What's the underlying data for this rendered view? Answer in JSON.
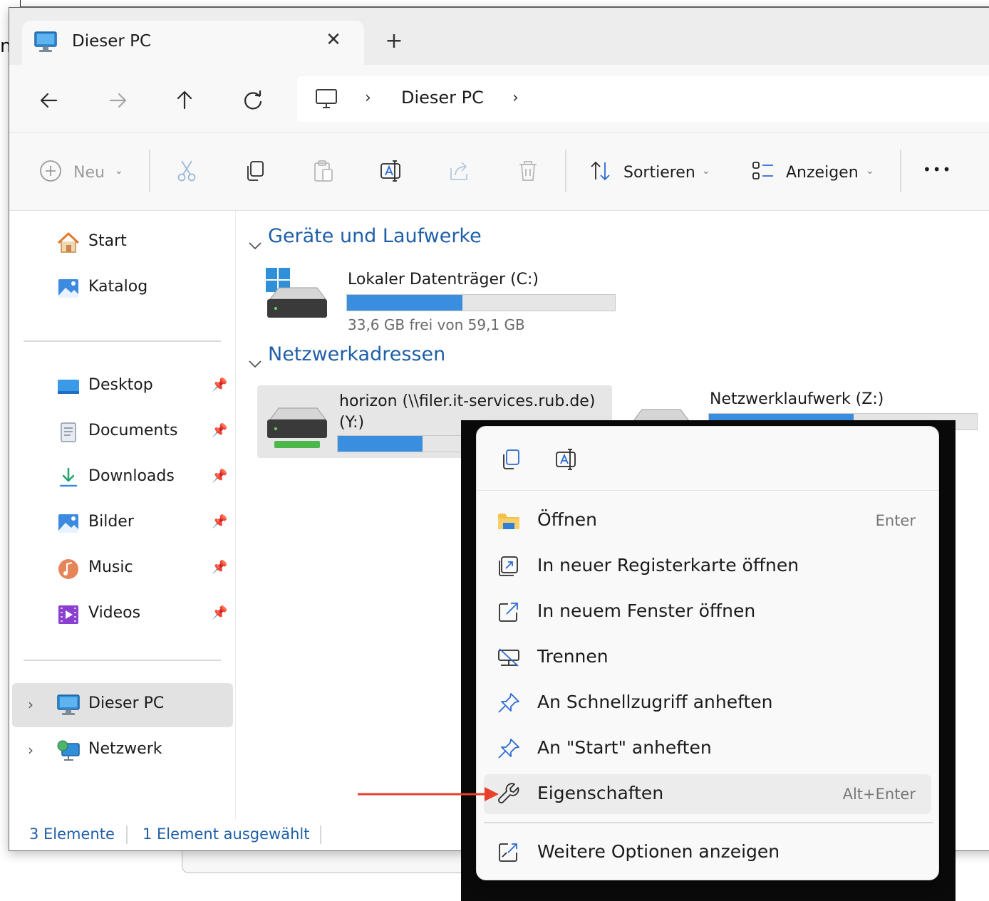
{
  "tab": {
    "title": "Dieser PC",
    "close_glyph": "✕",
    "new_tab_glyph": "+"
  },
  "nav": {
    "back_icon": "arrow-left-icon",
    "forward_icon": "arrow-right-icon",
    "up_icon": "arrow-up-icon",
    "refresh_icon": "refresh-icon",
    "breadcrumb": "Dieser PC"
  },
  "toolbar": {
    "new_label": "Neu",
    "sort_label": "Sortieren",
    "view_label": "Anzeigen",
    "more_label": "•••"
  },
  "sidebar": {
    "top_items": [
      {
        "label": "Start",
        "icon": "home-icon"
      },
      {
        "label": "Katalog",
        "icon": "gallery-icon"
      }
    ],
    "pinned": [
      {
        "label": "Desktop",
        "icon": "desktop-icon"
      },
      {
        "label": "Documents",
        "icon": "documents-icon"
      },
      {
        "label": "Downloads",
        "icon": "download-icon"
      },
      {
        "label": "Bilder",
        "icon": "pictures-icon"
      },
      {
        "label": "Music",
        "icon": "music-icon"
      },
      {
        "label": "Videos",
        "icon": "videos-icon"
      }
    ],
    "roots": [
      {
        "label": "Dieser PC",
        "icon": "pc-icon",
        "selected": true
      },
      {
        "label": "Netzwerk",
        "icon": "network-icon",
        "selected": false
      }
    ]
  },
  "content": {
    "group_devices": "Geräte und Laufwerke",
    "group_network": "Netzwerkadressen",
    "drive_c": {
      "name": "Lokaler Datenträger (C:)",
      "free_text": "33,6 GB frei von 59,1 GB",
      "used_fraction": 0.43
    },
    "drive_y": {
      "name_line1": "horizon (\\\\filer.it-services.rub.de)",
      "name_line2": "(Y:)",
      "used_fraction": 0.4
    },
    "drive_z": {
      "name": "Netzwerklaufwerk (Z:)",
      "used_fraction": 0.54
    }
  },
  "status": {
    "count": "3 Elemente",
    "selected": "1 Element ausgewählt"
  },
  "context_menu": {
    "quick_actions": [
      "copy-icon",
      "rename-icon"
    ],
    "items": [
      {
        "label": "Öffnen",
        "shortcut": "Enter",
        "icon": "folder-icon"
      },
      {
        "label": "In neuer Registerkarte öffnen",
        "shortcut": "",
        "icon": "new-tab-icon"
      },
      {
        "label": "In neuem Fenster öffnen",
        "shortcut": "",
        "icon": "new-window-icon"
      },
      {
        "label": "Trennen",
        "shortcut": "",
        "icon": "disconnect-icon"
      },
      {
        "label": "An Schnellzugriff anheften",
        "shortcut": "",
        "icon": "pin-icon"
      },
      {
        "label": "An \"Start\" anheften",
        "shortcut": "",
        "icon": "pin-icon"
      },
      {
        "label": "Eigenschaften",
        "shortcut": "Alt+Enter",
        "icon": "wrench-icon"
      },
      {
        "label": "Weitere Optionen anzeigen",
        "shortcut": "",
        "icon": "more-options-icon"
      }
    ]
  },
  "colors": {
    "accent": "#3a8ee0",
    "group_header": "#1f5fa8",
    "annotation_arrow": "#e8402a"
  }
}
